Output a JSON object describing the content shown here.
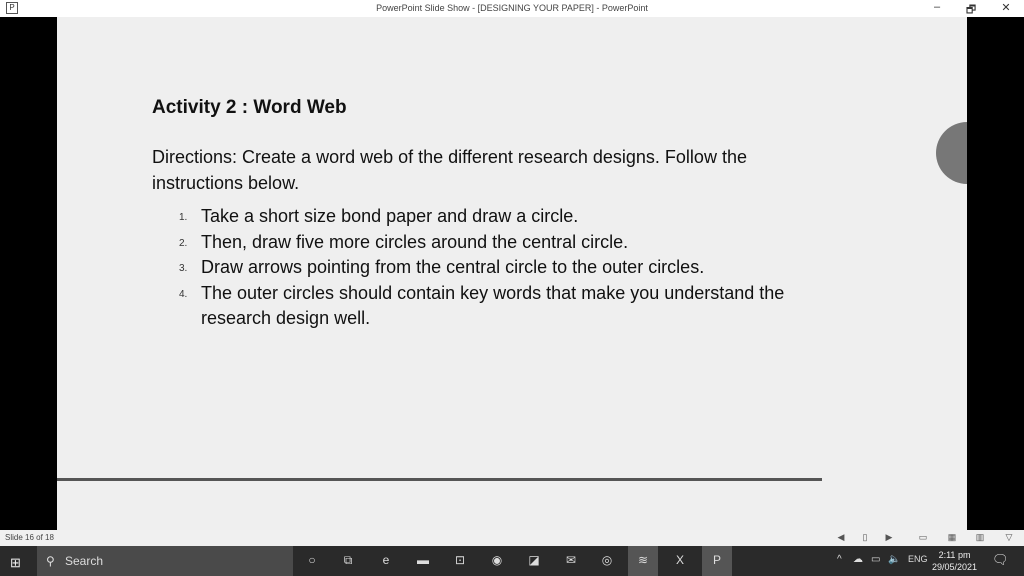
{
  "window": {
    "title": "PowerPoint Slide Show - [DESIGNING YOUR PAPER] - PowerPoint",
    "minimize": "–",
    "restore": "🗗",
    "close": "✕",
    "app_icon": "P"
  },
  "slide": {
    "title": "Activity 2 : Word Web",
    "directions": "Directions: Create a word web of the different research designs. Follow the instructions below.",
    "steps": [
      {
        "num": "1.",
        "text": "Take a short size bond paper and draw a circle."
      },
      {
        "num": "2.",
        "text": "Then, draw five more circles around the central circle."
      },
      {
        "num": "3.",
        "text": "Draw arrows pointing from the central circle to the outer circles."
      },
      {
        "num": "4.",
        "text": "The outer circles should contain key words that make you understand the research design well."
      }
    ]
  },
  "status": {
    "slide_counter": "Slide 16 of 18"
  },
  "taskbar": {
    "search": "Search",
    "time": "2:11 pm",
    "date": "29/05/2021",
    "lang": "ENG"
  }
}
